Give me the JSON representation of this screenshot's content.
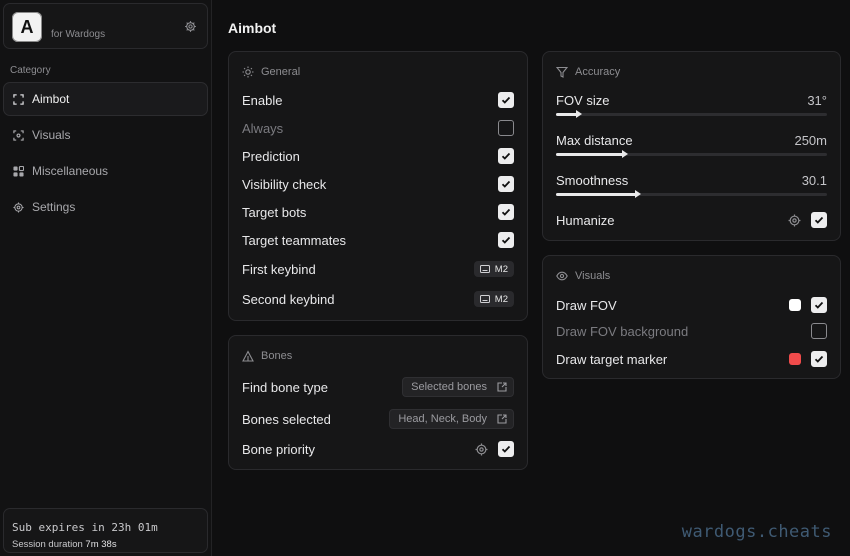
{
  "brand": {
    "logo": "A",
    "subtitle": "for Wardogs"
  },
  "sidebar": {
    "category_label": "Category",
    "items": [
      {
        "label": "Aimbot",
        "icon": "crosshair-icon",
        "active": true
      },
      {
        "label": "Visuals",
        "icon": "eye-target-icon",
        "active": false
      },
      {
        "label": "Miscellaneous",
        "icon": "blocks-icon",
        "active": false
      },
      {
        "label": "Settings",
        "icon": "gear-icon",
        "active": false
      }
    ],
    "subscription": {
      "expires": "Sub expires in 23h 01m",
      "session_label": "Session duration",
      "session_value": "7m 38s"
    }
  },
  "page_title": "Aimbot",
  "general": {
    "title": "General",
    "rows": [
      {
        "label": "Enable",
        "checked": true,
        "dim": false
      },
      {
        "label": "Always",
        "checked": false,
        "dim": true
      },
      {
        "label": "Prediction",
        "checked": true,
        "dim": false
      },
      {
        "label": "Visibility check",
        "checked": true,
        "dim": false
      },
      {
        "label": "Target bots",
        "checked": true,
        "dim": false
      },
      {
        "label": "Target teammates",
        "checked": true,
        "dim": false
      }
    ],
    "keybinds": [
      {
        "label": "First keybind",
        "key": "M2"
      },
      {
        "label": "Second keybind",
        "key": "M2"
      }
    ]
  },
  "bones": {
    "title": "Bones",
    "find_bone_type": {
      "label": "Find bone type",
      "value": "Selected bones"
    },
    "bones_selected": {
      "label": "Bones selected",
      "value": "Head, Neck, Body"
    },
    "bone_priority": {
      "label": "Bone priority",
      "checked": true
    }
  },
  "accuracy": {
    "title": "Accuracy",
    "sliders": [
      {
        "label": "FOV size",
        "value": "31°",
        "fraction": 0.08
      },
      {
        "label": "Max distance",
        "value": "250m",
        "fraction": 0.25
      },
      {
        "label": "Smoothness",
        "value": "30.1",
        "fraction": 0.3
      }
    ],
    "humanize": {
      "label": "Humanize",
      "checked": true
    }
  },
  "visuals": {
    "title": "Visuals",
    "rows": [
      {
        "label": "Draw FOV",
        "checked": true,
        "dim": false,
        "color": "#ffffff"
      },
      {
        "label": "Draw FOV background",
        "checked": false,
        "dim": true,
        "color": null
      },
      {
        "label": "Draw target marker",
        "checked": true,
        "dim": false,
        "color": "#f04b4b"
      }
    ]
  },
  "watermark": "wardogs.cheats"
}
